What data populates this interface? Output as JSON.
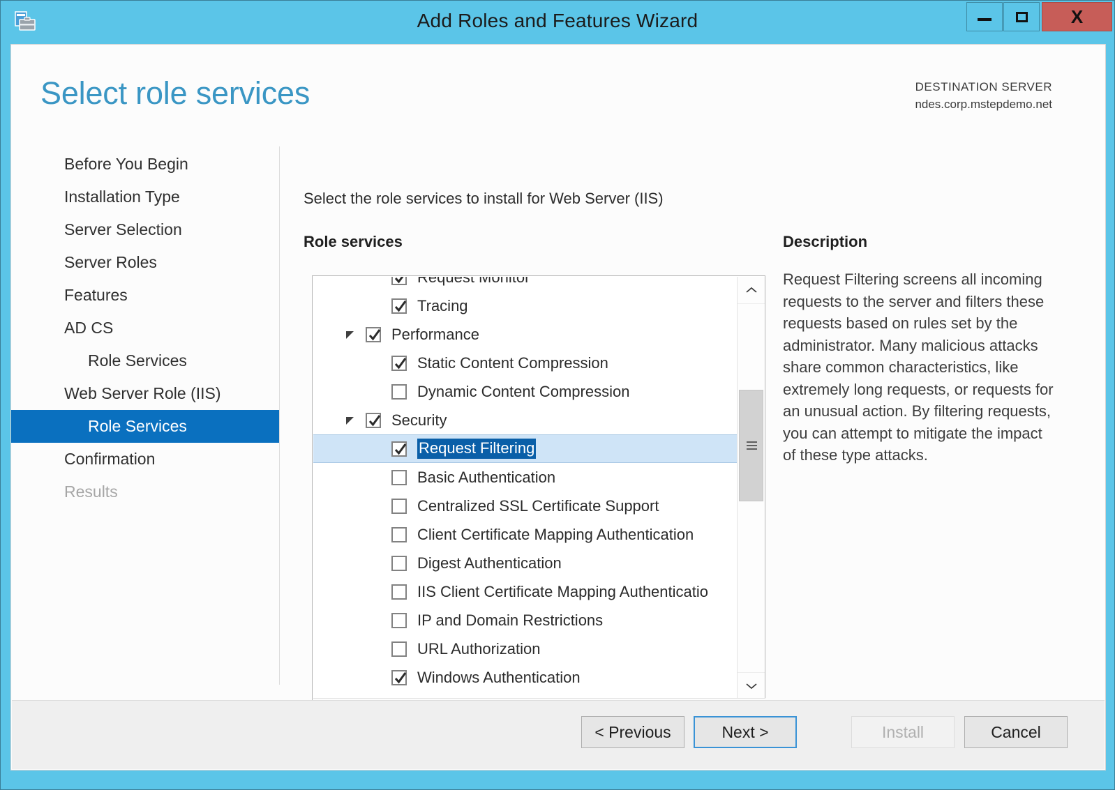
{
  "window": {
    "title": "Add Roles and Features Wizard",
    "icon": "wizard-toolbox-icon",
    "accent_color": "#5bc5e8",
    "close_color": "#c75d58",
    "controls": {
      "minimize": "minimize-icon",
      "maximize": "maximize-icon",
      "close": "X"
    }
  },
  "header": {
    "page_title": "Select role services",
    "destination_label": "DESTINATION SERVER",
    "destination_server": "ndes.corp.mstepdemo.net",
    "title_color": "#3a96c4"
  },
  "sidebar": {
    "selected_color": "#0a70bf",
    "items": [
      {
        "label": "Before You Begin",
        "state": "normal",
        "indent": 0
      },
      {
        "label": "Installation Type",
        "state": "normal",
        "indent": 0
      },
      {
        "label": "Server Selection",
        "state": "normal",
        "indent": 0
      },
      {
        "label": "Server Roles",
        "state": "normal",
        "indent": 0
      },
      {
        "label": "Features",
        "state": "normal",
        "indent": 0
      },
      {
        "label": "AD CS",
        "state": "normal",
        "indent": 0
      },
      {
        "label": "Role Services",
        "state": "normal",
        "indent": 1
      },
      {
        "label": "Web Server Role (IIS)",
        "state": "normal",
        "indent": 0
      },
      {
        "label": "Role Services",
        "state": "selected",
        "indent": 1
      },
      {
        "label": "Confirmation",
        "state": "normal",
        "indent": 0
      },
      {
        "label": "Results",
        "state": "disabled",
        "indent": 0
      }
    ]
  },
  "content": {
    "instruction": "Select the role services to install for Web Server (IIS)",
    "role_services_label": "Role services",
    "description_label": "Description",
    "description_text": "Request Filtering screens all incoming requests to the server and filters these requests based on rules set by the administrator. Many malicious attacks share common characteristics, like extremely long requests, or requests for an unusual action. By filtering requests, you can attempt to mitigate the impact of these type attacks.",
    "tree": [
      {
        "label": "Request Monitor",
        "checked": true,
        "level": 2,
        "expander": "none",
        "selected": false,
        "clipped_top": true
      },
      {
        "label": "Tracing",
        "checked": true,
        "level": 2,
        "expander": "none",
        "selected": false
      },
      {
        "label": "Performance",
        "checked": true,
        "level": 1,
        "expander": "expanded",
        "selected": false
      },
      {
        "label": "Static Content Compression",
        "checked": true,
        "level": 2,
        "expander": "none",
        "selected": false
      },
      {
        "label": "Dynamic Content Compression",
        "checked": false,
        "level": 2,
        "expander": "none",
        "selected": false
      },
      {
        "label": "Security",
        "checked": true,
        "level": 1,
        "expander": "expanded",
        "selected": false
      },
      {
        "label": "Request Filtering",
        "checked": true,
        "level": 2,
        "expander": "none",
        "selected": true
      },
      {
        "label": "Basic Authentication",
        "checked": false,
        "level": 2,
        "expander": "none",
        "selected": false
      },
      {
        "label": "Centralized SSL Certificate Support",
        "checked": false,
        "level": 2,
        "expander": "none",
        "selected": false
      },
      {
        "label": "Client Certificate Mapping Authentication",
        "checked": false,
        "level": 2,
        "expander": "none",
        "selected": false
      },
      {
        "label": "Digest Authentication",
        "checked": false,
        "level": 2,
        "expander": "none",
        "selected": false
      },
      {
        "label": "IIS Client Certificate Mapping Authenticatio",
        "checked": false,
        "level": 2,
        "expander": "none",
        "selected": false,
        "clipped_right": true
      },
      {
        "label": "IP and Domain Restrictions",
        "checked": false,
        "level": 2,
        "expander": "none",
        "selected": false
      },
      {
        "label": "URL Authorization",
        "checked": false,
        "level": 2,
        "expander": "none",
        "selected": false
      },
      {
        "label": "Windows Authentication",
        "checked": true,
        "level": 2,
        "expander": "none",
        "selected": false,
        "clipped_bottom": true
      }
    ],
    "scrollbars": {
      "vertical_up": "chevron-up-icon",
      "vertical_down": "chevron-down-icon",
      "horizontal_left": "chevron-left-icon",
      "horizontal_right": "chevron-right-icon"
    }
  },
  "footer": {
    "previous": "< Previous",
    "next": "Next >",
    "install": "Install",
    "cancel": "Cancel",
    "install_enabled": false,
    "next_focused": true
  }
}
